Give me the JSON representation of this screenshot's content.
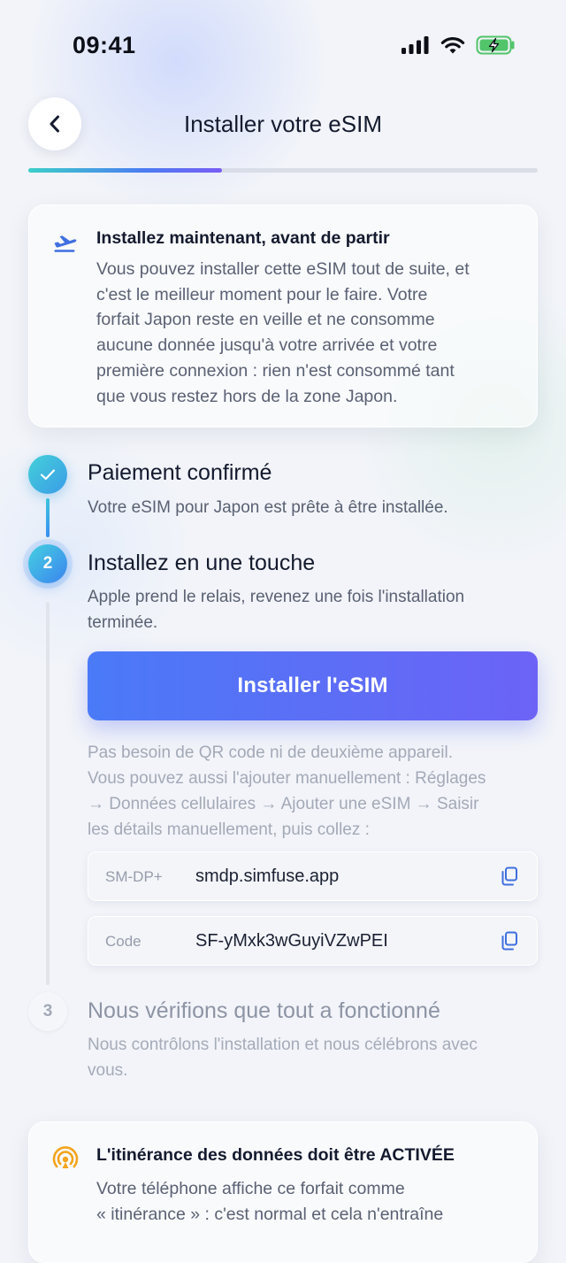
{
  "status_bar": {
    "time": "09:41"
  },
  "header": {
    "title": "Installer votre eSIM"
  },
  "progress": {
    "fraction": 0.38
  },
  "info_card": {
    "icon": "plane-departure-icon",
    "title": "Installez maintenant, avant de partir",
    "body_lines": [
      "Vous pouvez installer cette eSIM tout de suite, et",
      "c'est le meilleur moment pour le faire. Votre",
      "forfait Japon reste en veille et ne consomme",
      "aucune donnée jusqu'à votre arrivée et votre",
      "première connexion : rien n'est consommé tant",
      "que vous restez hors de la zone Japon."
    ]
  },
  "steps": [
    {
      "status": "done",
      "marker": "✓",
      "title": "Paiement confirmé",
      "desc_lines": [
        "Votre eSIM pour Japon est prête à être installée."
      ]
    },
    {
      "status": "active",
      "marker": "2",
      "title": "Installez en une touche",
      "desc_lines": [
        "Apple prend le relais, revenez une fois l'installation",
        "terminée."
      ]
    },
    {
      "status": "pending",
      "marker": "3",
      "title": "Nous vérifions que tout a fonctionné",
      "desc_lines": [
        "Nous contrôlons l'installation et nous célébrons avec",
        "vous."
      ]
    }
  ],
  "install_button": {
    "label": "Installer l'eSIM"
  },
  "manual_note_lines": [
    "Pas besoin de QR code ni de deuxième appareil.",
    "Vous pouvez aussi l'ajouter manuellement : Réglages",
    "→ Données cellulaires → Ajouter une eSIM → Saisir",
    "les détails manuellement, puis collez :"
  ],
  "fields": [
    {
      "label": "SM-DP+",
      "value": "smdp.simfuse.app"
    },
    {
      "label": "Code",
      "value": "SF-yMxk3wGuyiVZwPEI"
    }
  ],
  "warning_card": {
    "icon": "roaming-signal-icon",
    "title": "L'itinérance des données doit être ACTIVÉE",
    "body_lines": [
      "Votre téléphone affiche ce forfait comme",
      "« itinérance » : c'est normal et cela n'entraîne"
    ]
  },
  "colors": {
    "accent": "#4a7af7",
    "accent_end": "#6c63f6",
    "success": "#3ab0e0",
    "warning": "#f3a41c"
  }
}
